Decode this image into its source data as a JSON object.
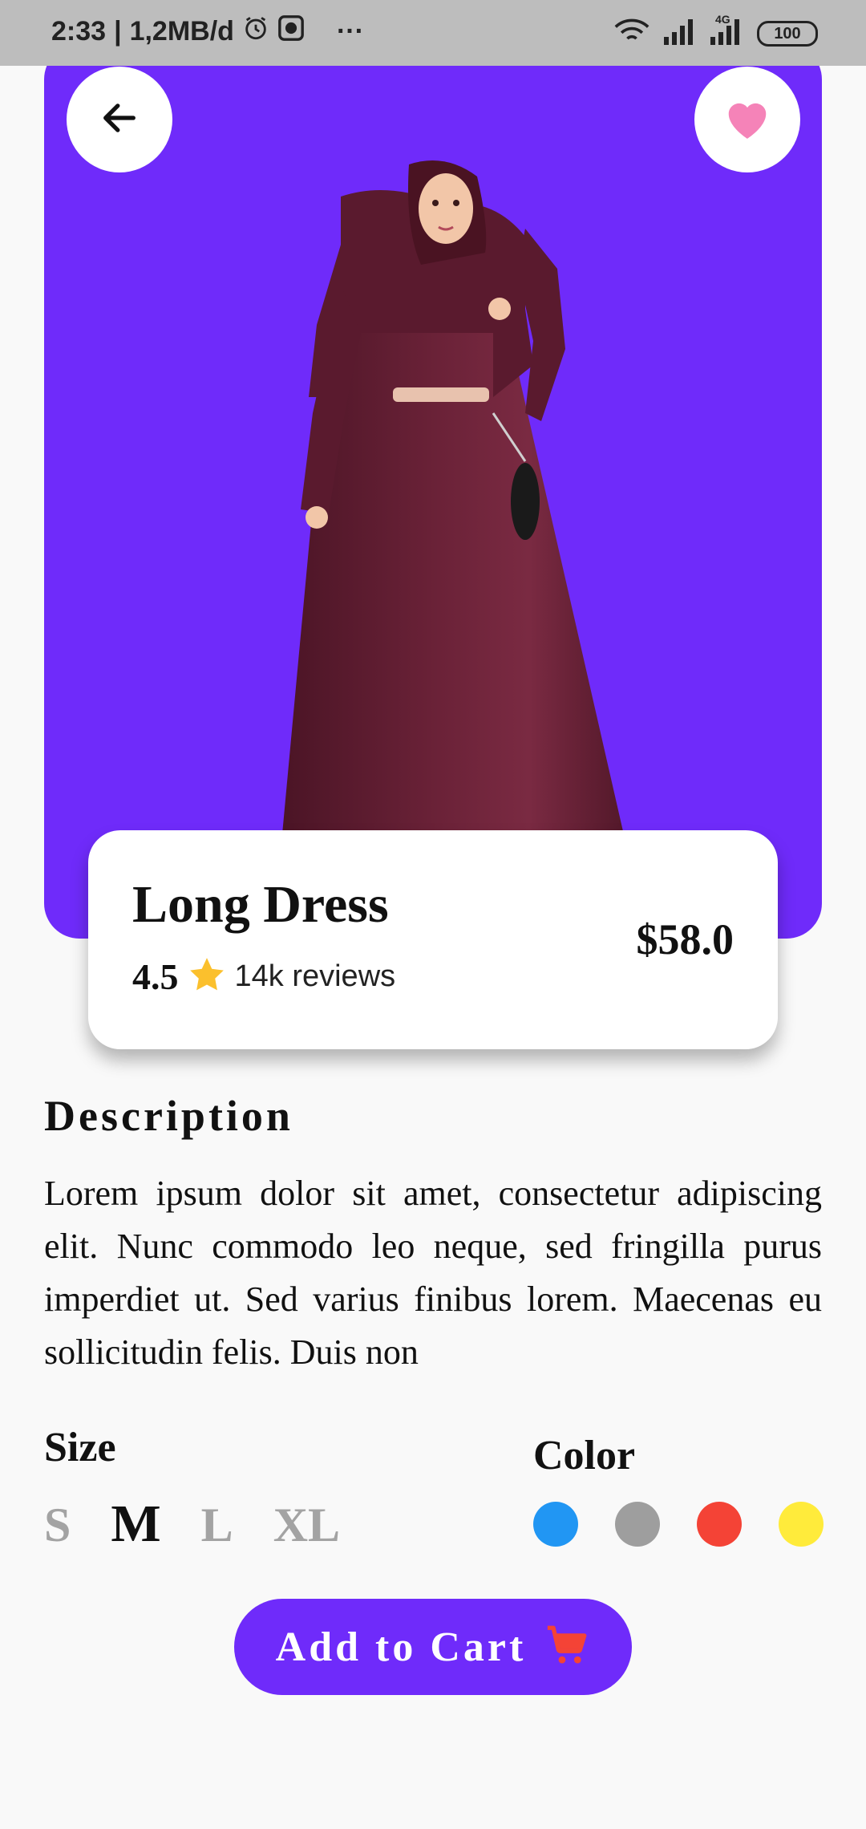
{
  "status_bar": {
    "time": "2:33",
    "net_speed": "1,2MB/d",
    "more": "···",
    "network_type": "4G",
    "battery": "100"
  },
  "product": {
    "name": "Long Dress",
    "rating": "4.5",
    "reviews": "14k reviews",
    "price": "$58.0",
    "hero_color": "#6f2bfa"
  },
  "description": {
    "title": "Description",
    "text": "Lorem ipsum dolor sit amet, consectetur adipiscing elit. Nunc commodo leo neque, sed fringilla purus imperdiet ut. Sed varius finibus lorem. Maecenas eu sollicitudin felis. Duis non"
  },
  "size": {
    "title": "Size",
    "options": [
      "S",
      "M",
      "L",
      "XL"
    ],
    "selected": "M"
  },
  "color": {
    "title": "Color",
    "options": [
      "#2196f3",
      "#9e9e9e",
      "#f44336",
      "#ffeb3b"
    ]
  },
  "cart": {
    "label": "Add to Cart",
    "icon_color": "#f44336"
  },
  "icons": {
    "back": "arrow-left-icon",
    "favorite": "heart-icon",
    "rating": "star-icon",
    "cart": "shopping-cart-icon"
  }
}
